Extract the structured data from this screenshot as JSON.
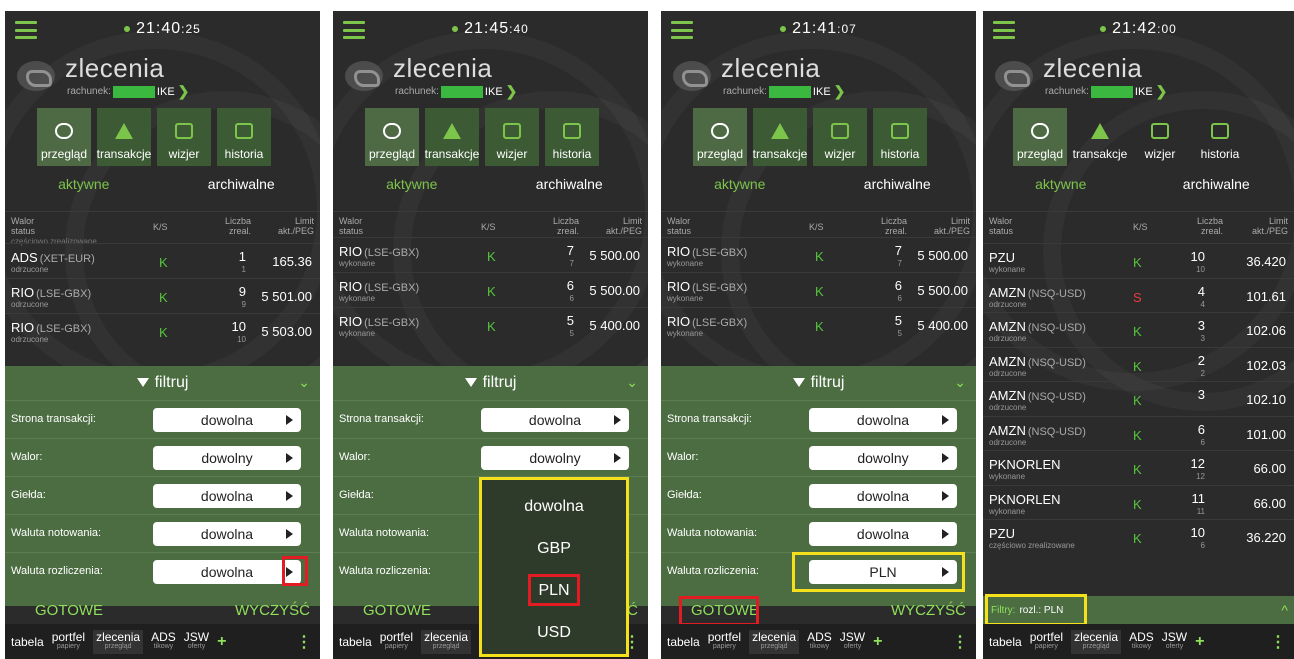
{
  "panels": [
    {
      "time": "21:40",
      "time_sec": ":25",
      "rows": [
        {
          "ticker": "ADS",
          "exch": "(XET-EUR)",
          "status": "odrzucone",
          "ks": "K",
          "qty": "1",
          "qty2": "1",
          "lim": "165.36"
        },
        {
          "ticker": "RIO",
          "exch": "(LSE-GBX)",
          "status": "odrzucone",
          "ks": "K",
          "qty": "9",
          "qty2": "9",
          "lim": "5 501.00"
        },
        {
          "ticker": "RIO",
          "exch": "(LSE-GBX)",
          "status": "odrzucone",
          "ks": "K",
          "qty": "10",
          "qty2": "10",
          "lim": "5 503.00"
        }
      ],
      "filter_values": [
        "dowolna",
        "dowolny",
        "dowolna",
        "dowolna",
        "dowolna"
      ]
    },
    {
      "time": "21:45",
      "time_sec": ":40",
      "rows": [
        {
          "ticker": "RIO",
          "exch": "(LSE-GBX)",
          "status": "wykonane",
          "ks": "K",
          "qty": "7",
          "qty2": "7",
          "lim": "5 500.00"
        },
        {
          "ticker": "RIO",
          "exch": "(LSE-GBX)",
          "status": "wykonane",
          "ks": "K",
          "qty": "6",
          "qty2": "6",
          "lim": "5 500.00"
        },
        {
          "ticker": "RIO",
          "exch": "(LSE-GBX)",
          "status": "wykonane",
          "ks": "K",
          "qty": "5",
          "qty2": "5",
          "lim": "5 400.00"
        }
      ],
      "filter_values": [
        "dowolna",
        "dowolny",
        "",
        "",
        ""
      ],
      "dropdown": [
        "dowolna",
        "GBP",
        "PLN",
        "USD"
      ]
    },
    {
      "time": "21:41",
      "time_sec": ":07",
      "rows": [
        {
          "ticker": "RIO",
          "exch": "(LSE-GBX)",
          "status": "wykonane",
          "ks": "K",
          "qty": "7",
          "qty2": "7",
          "lim": "5 500.00"
        },
        {
          "ticker": "RIO",
          "exch": "(LSE-GBX)",
          "status": "wykonane",
          "ks": "K",
          "qty": "6",
          "qty2": "6",
          "lim": "5 500.00"
        },
        {
          "ticker": "RIO",
          "exch": "(LSE-GBX)",
          "status": "wykonane",
          "ks": "K",
          "qty": "5",
          "qty2": "5",
          "lim": "5 400.00"
        }
      ],
      "filter_values": [
        "dowolna",
        "dowolny",
        "dowolna",
        "dowolna",
        "PLN"
      ]
    },
    {
      "time": "21:42",
      "time_sec": ":00",
      "rows": [
        {
          "ticker": "PZU",
          "exch": "",
          "status": "wykonane",
          "ks": "K",
          "qty": "10",
          "qty2": "10",
          "lim": "36.420"
        },
        {
          "ticker": "AMZN",
          "exch": "(NSQ-USD)",
          "status": "odrzucone",
          "ks": "S",
          "qty": "4",
          "qty2": "4",
          "lim": "101.61"
        },
        {
          "ticker": "AMZN",
          "exch": "(NSQ-USD)",
          "status": "odrzucone",
          "ks": "K",
          "qty": "3",
          "qty2": "3",
          "lim": "102.06"
        },
        {
          "ticker": "AMZN",
          "exch": "(NSQ-USD)",
          "status": "odrzucone",
          "ks": "K",
          "qty": "2",
          "qty2": "2",
          "lim": "102.03"
        },
        {
          "ticker": "AMZN",
          "exch": "(NSQ-USD)",
          "status": "odrzucone",
          "ks": "K",
          "qty": "3",
          "qty2": "",
          "lim": "102.10"
        },
        {
          "ticker": "AMZN",
          "exch": "(NSQ-USD)",
          "status": "odrzucone",
          "ks": "K",
          "qty": "6",
          "qty2": "6",
          "lim": "101.00"
        },
        {
          "ticker": "PKNORLEN",
          "exch": "",
          "status": "wykonane",
          "ks": "K",
          "qty": "12",
          "qty2": "12",
          "lim": "66.00"
        },
        {
          "ticker": "PKNORLEN",
          "exch": "",
          "status": "wykonane",
          "ks": "K",
          "qty": "11",
          "qty2": "11",
          "lim": "66.00"
        },
        {
          "ticker": "PZU",
          "exch": "",
          "status": "częściowo zrealizowane",
          "ks": "K",
          "qty": "10",
          "qty2": "6",
          "lim": "36.220"
        }
      ]
    }
  ],
  "common": {
    "title": "zlecenia",
    "account_prefix": "rachunek:",
    "account_suffix": "IKE",
    "tabs": [
      "przegląd",
      "transakcje",
      "wizjer",
      "historia"
    ],
    "subtabs": [
      "aktywne",
      "archiwalne"
    ],
    "col_walor": "Walor",
    "col_status": "status",
    "col_ks": "K/S",
    "col_liczba": "Liczba",
    "col_zreal": "zreal.",
    "col_limit": "Limit",
    "col_akt": "akt./PEG",
    "filter_title": "filtruj",
    "filter_labels": [
      "Strona transakcji:",
      "Walor:",
      "Giełda:",
      "Waluta notowania:",
      "Waluta rozliczenia:"
    ],
    "ok": "GOTOWE",
    "clear": "WYCZYŚĆ",
    "filters_prefix": "Filtry:",
    "filters_value": "rozl.: PLN",
    "bottom": [
      {
        "label": "tabela",
        "sub": ""
      },
      {
        "label": "portfel",
        "sub": "papiery"
      },
      {
        "label": "zlecenia",
        "sub": "przegląd"
      },
      {
        "label": "ADS",
        "sub": "tikowy"
      },
      {
        "label": "JSW",
        "sub": "oferty"
      }
    ],
    "peek_row": "częściowo zrealizowane"
  },
  "colors": {
    "accent": "#7cc44a",
    "panel_bg": "#2b2b2b",
    "filter_bg": "#4b6d41",
    "highlight_red": "#e31b23",
    "highlight_yellow": "#f4e11c",
    "sell": "#e43d3d"
  }
}
